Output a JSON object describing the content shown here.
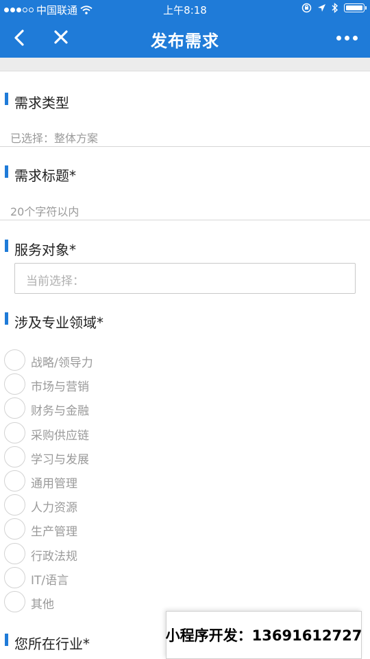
{
  "status_bar": {
    "carrier": "中国联通",
    "time": "上午8:18"
  },
  "nav": {
    "title": "发布需求",
    "back_icon": "chevron-left-icon",
    "close_icon": "close-icon",
    "more_icon": "more-dots-icon"
  },
  "form": {
    "type_section": {
      "title": "需求类型",
      "value": "已选择：整体方案"
    },
    "title_section": {
      "title": "需求标题*",
      "placeholder": "20个字符以内"
    },
    "service_section": {
      "title": "服务对象*",
      "placeholder": "当前选择："
    },
    "domain_section": {
      "title": "涉及专业领域*",
      "options": [
        {
          "label": "战略/领导力"
        },
        {
          "label": "市场与营销"
        },
        {
          "label": "财务与金融"
        },
        {
          "label": "采购供应链"
        },
        {
          "label": "学习与发展"
        },
        {
          "label": "通用管理"
        },
        {
          "label": "人力资源"
        },
        {
          "label": "生产管理"
        },
        {
          "label": "行政法规"
        },
        {
          "label": "IT/语言"
        },
        {
          "label": "其他"
        }
      ]
    },
    "industry_section": {
      "title": "您所在行业*"
    }
  },
  "watermark": {
    "text": "小程序开发：13691612727"
  },
  "colors": {
    "accent": "#1f7bd8",
    "placeholder": "#9a9a9a"
  }
}
